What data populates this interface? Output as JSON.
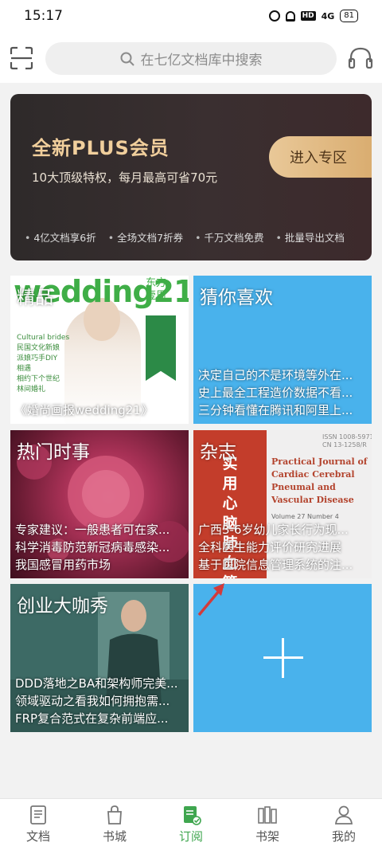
{
  "status_bar": {
    "time": "15:17",
    "network": "4G",
    "battery": "81"
  },
  "header": {
    "search_placeholder": "在七亿文档库中搜索"
  },
  "banner": {
    "title": "全新PLUS会员",
    "subtitle": "10大顶级特权，每月最高可省70元",
    "button": "进入专区",
    "features": [
      "4亿文档享6折",
      "全场文档7折券",
      "千万文档免费",
      "批量导出文档"
    ],
    "accent_color": "#f1cf9c"
  },
  "tiles": {
    "jingpin": {
      "title": "精品",
      "line": "《婚尚画报wedding21》",
      "cover_word": "wedding21",
      "cover_corner": "东方\n壹周",
      "cover_side": "Cultural brides\n民国文化新娘\n派娘巧手DIY\n相遇\n相约下个世纪\n林间婚礼"
    },
    "guess": {
      "title": "猜你喜欢",
      "lines": [
        "决定自己的不是环境等外在...",
        "史上最全工程造价数据不看...",
        "三分钟看懂在腾讯和阿里上..."
      ]
    },
    "hot": {
      "title": "热门时事",
      "lines": [
        "专家建议：一般患者可在家...",
        "科学消毒防范新冠病毒感染...",
        "我国感冒用药市场"
      ]
    },
    "magazine": {
      "title": "杂志",
      "lines": [
        "广西3-6岁幼儿家长行为现...",
        "全科医生能力评价研究进展",
        "基于医院信息管理系统的注..."
      ],
      "cover_cn": "实用心脑肺血管病",
      "cover_en": "Practical Journal of\nCardiac Cerebral\nPneumal and\nVascular Disease",
      "cover_issn": "ISSN 1008-5971\nCN 13-1258/R",
      "cover_vol": "Volume 27   Number 4"
    },
    "startup": {
      "title": "创业大咖秀",
      "lines": [
        "DDD落地之BA和架构师完美...",
        "领域驱动之看我如何拥抱需...",
        "FRP复合范式在复杂前端应..."
      ]
    }
  },
  "nav": [
    {
      "label": "文档",
      "icon": "document-icon",
      "active": false
    },
    {
      "label": "书城",
      "icon": "shopping-bag-icon",
      "active": false
    },
    {
      "label": "订阅",
      "icon": "subscribe-icon",
      "active": true
    },
    {
      "label": "书架",
      "icon": "bookshelf-icon",
      "active": false
    },
    {
      "label": "我的",
      "icon": "user-icon",
      "active": false
    }
  ],
  "colors": {
    "active": "#3fa64f",
    "tile_blue": "#49b2ec"
  }
}
